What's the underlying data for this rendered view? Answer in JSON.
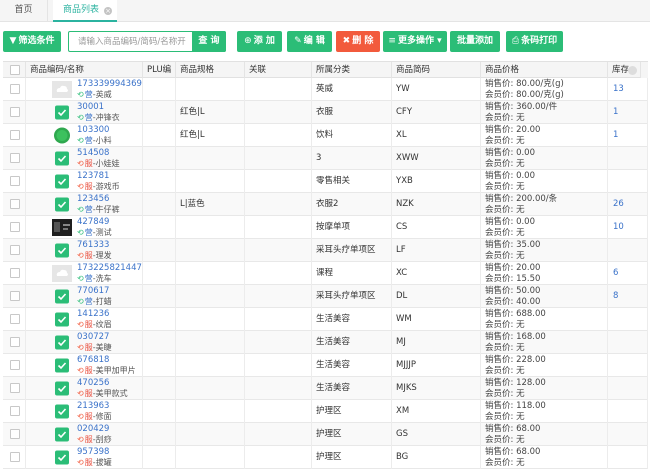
{
  "tabs": [
    {
      "label": "首页"
    },
    {
      "label": "商品列表"
    }
  ],
  "toolbar": {
    "filter_label": "筛选条件",
    "search_placeholder": "请输入商品编码/简码/名称开",
    "search_value": "",
    "search_button": "查 询",
    "add_label": "添 加",
    "edit_label": "编 辑",
    "delete_label": "删 除",
    "more_label": "更多操作",
    "batch_add_label": "批量添加",
    "barcode_print_label": "条码打印"
  },
  "table": {
    "headers": {
      "code_name": "商品编码/名称",
      "plu": "PLU编",
      "spec": "商品规格",
      "related": "关联",
      "category": "所属分类",
      "shortcode": "商品简码",
      "price": "商品价格",
      "stock": "库存"
    },
    "expand_label": "展开",
    "rows": [
      {
        "code": "173339994369",
        "type": "营",
        "name": "英威",
        "thumb": "placeholder",
        "spec": "",
        "expand": false,
        "category": "英威",
        "shortcode": "YW",
        "sale": "销售价: 80.00/克(g)",
        "member": "会员价: 80.00/克(g)",
        "stock": "13"
      },
      {
        "code": "30001",
        "type": "营",
        "name": "冲锋衣",
        "thumb": "green",
        "spec": "红色|L",
        "expand": true,
        "category": "衣服",
        "shortcode": "CFY",
        "sale": "销售价: 360.00/件",
        "member": "会员价: 无",
        "stock": "1"
      },
      {
        "code": "103300",
        "type": "营",
        "name": "小料",
        "thumb": "green-circle",
        "spec": "红色|L",
        "expand": true,
        "category": "饮料",
        "shortcode": "XL",
        "sale": "销售价: 20.00",
        "member": "会员价: 无",
        "stock": "1"
      },
      {
        "code": "514508",
        "type": "服",
        "name": "小娃娃",
        "thumb": "green",
        "spec": "",
        "expand": false,
        "category": "3",
        "shortcode": "XWW",
        "sale": "销售价: 0.00",
        "member": "会员价: 无",
        "stock": ""
      },
      {
        "code": "123781",
        "type": "服",
        "name": "游戏币",
        "thumb": "green",
        "spec": "",
        "expand": false,
        "category": "零售相关",
        "shortcode": "YXB",
        "sale": "销售价: 0.00",
        "member": "会员价: 无",
        "stock": ""
      },
      {
        "code": "123456",
        "type": "营",
        "name": "牛仔裤",
        "thumb": "green",
        "spec": "L|蓝色",
        "expand": false,
        "category": "衣服2",
        "shortcode": "NZK",
        "sale": "销售价: 200.00/条",
        "member": "会员价: 无",
        "stock": "26"
      },
      {
        "code": "427849",
        "type": "营",
        "name": "测试",
        "thumb": "dark",
        "spec": "",
        "expand": false,
        "category": "按摩单项",
        "shortcode": "CS",
        "sale": "销售价: 0.00",
        "member": "会员价: 无",
        "stock": "10"
      },
      {
        "code": "761333",
        "type": "服",
        "name": "理发",
        "thumb": "green",
        "spec": "",
        "expand": false,
        "category": "采耳头疗单项区",
        "shortcode": "LF",
        "sale": "销售价: 35.00",
        "member": "会员价: 无",
        "stock": ""
      },
      {
        "code": "173225821447",
        "type": "营",
        "name": "洗车",
        "thumb": "placeholder",
        "spec": "",
        "expand": false,
        "category": "课程",
        "shortcode": "XC",
        "sale": "销售价: 20.00",
        "member": "会员价: 15.50",
        "stock": "6"
      },
      {
        "code": "770617",
        "type": "营",
        "name": "打蜡",
        "thumb": "green",
        "spec": "",
        "expand": false,
        "category": "采耳头疗单项区",
        "shortcode": "DL",
        "sale": "销售价: 50.00",
        "member": "会员价: 40.00",
        "stock": "8"
      },
      {
        "code": "141236",
        "type": "服",
        "name": "纹眉",
        "thumb": "green",
        "spec": "",
        "expand": false,
        "category": "生活美容",
        "shortcode": "WM",
        "sale": "销售价: 688.00",
        "member": "会员价: 无",
        "stock": ""
      },
      {
        "code": "030727",
        "type": "服",
        "name": "美睫",
        "thumb": "green",
        "spec": "",
        "expand": false,
        "category": "生活美容",
        "shortcode": "MJ",
        "sale": "销售价: 168.00",
        "member": "会员价: 无",
        "stock": ""
      },
      {
        "code": "676818",
        "type": "服",
        "name": "美甲加甲片",
        "thumb": "green",
        "spec": "",
        "expand": false,
        "category": "生活美容",
        "shortcode": "MJJJP",
        "sale": "销售价: 228.00",
        "member": "会员价: 无",
        "stock": ""
      },
      {
        "code": "470256",
        "type": "服",
        "name": "美甲款式",
        "thumb": "green",
        "spec": "",
        "expand": false,
        "category": "生活美容",
        "shortcode": "MJKS",
        "sale": "销售价: 128.00",
        "member": "会员价: 无",
        "stock": ""
      },
      {
        "code": "213963",
        "type": "服",
        "name": "修面",
        "thumb": "green",
        "spec": "",
        "expand": false,
        "category": "护理区",
        "shortcode": "XM",
        "sale": "销售价: 118.00",
        "member": "会员价: 无",
        "stock": ""
      },
      {
        "code": "020429",
        "type": "服",
        "name": "刮痧",
        "thumb": "green",
        "spec": "",
        "expand": false,
        "category": "护理区",
        "shortcode": "GS",
        "sale": "销售价: 68.00",
        "member": "会员价: 无",
        "stock": ""
      },
      {
        "code": "957398",
        "type": "服",
        "name": "拔罐",
        "thumb": "green",
        "spec": "",
        "expand": false,
        "category": "护理区",
        "shortcode": "BG",
        "sale": "销售价: 68.00",
        "member": "会员价: 无",
        "stock": ""
      }
    ]
  },
  "colors": {
    "accent": "#2bbd77",
    "danger": "#f25a3c",
    "link": "#3a72c9",
    "tab_active": "#2bb3a0",
    "expand_badge": "#4a90d9"
  }
}
